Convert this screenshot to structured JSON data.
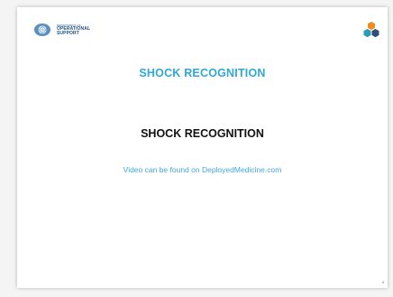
{
  "header": {
    "department_small": "DEPARTMENT OF",
    "department_line1": "OPERATIONAL",
    "department_line2": "SUPPORT",
    "un_logo_icon": "un-emblem-icon",
    "corner_logo_icon": "hexagon-cluster-icon"
  },
  "slide": {
    "section_title": "SHOCK RECOGNITION",
    "main_title": "SHOCK RECOGNITION",
    "video_note": "Video can be found on DeployedMedicine.com",
    "page_number": "4"
  },
  "colors": {
    "accent_blue": "#2fa8d6",
    "link_blue": "#3fa8d8",
    "title_dark": "#111111",
    "un_blue": "#2b5c8a",
    "hex_orange": "#f08a24",
    "hex_teal": "#2a9db5",
    "hex_navy": "#2d4f73"
  }
}
